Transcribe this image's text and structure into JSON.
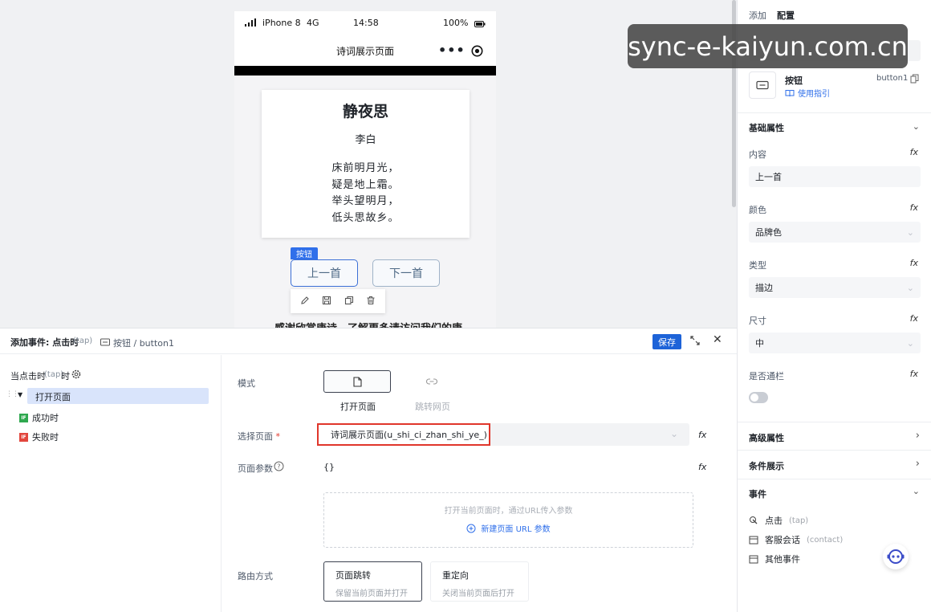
{
  "phone": {
    "carrier": "iPhone 8",
    "network": "4G",
    "time": "14:58",
    "battery": "100%",
    "nav_title": "诗词展示页面",
    "poem": {
      "title": "静夜思",
      "author": "李白",
      "lines": [
        "床前明月光，",
        "疑是地上霜。",
        "举头望明月，",
        "低头思故乡。"
      ]
    },
    "prev_label": "上一首",
    "next_label": "下一首",
    "selected_tag": "按钮",
    "cut_text": "感谢欣赏唐诗，了解更多请访问我们的唐"
  },
  "watermark": "sync-e-kaiyun.com.cn",
  "right_panel": {
    "tabs": [
      "添加",
      "配置"
    ],
    "component_name": "按钮",
    "component_id": "button1",
    "guide_link": "使用指引",
    "basic_section": "基础属性",
    "props": [
      {
        "label": "内容",
        "value": "上一首"
      },
      {
        "label": "颜色",
        "value": "品牌色"
      },
      {
        "label": "类型",
        "value": "描边"
      },
      {
        "label": "尺寸",
        "value": "中"
      }
    ],
    "full_width_label": "是否通栏",
    "full_width_on": false,
    "advanced_section": "高级属性",
    "condition_section": "条件展示",
    "events_section": "事件",
    "events": [
      {
        "label": "点击",
        "sub": "(tap)"
      },
      {
        "label": "客服会话",
        "sub": "(contact)"
      },
      {
        "label": "其他事件",
        "sub": ""
      }
    ]
  },
  "editor": {
    "title": "添加事件: 点击时",
    "title_sub": "(tap)",
    "component_path": "按钮 / button1",
    "save_label": "保存",
    "trigger_label": "当点击时",
    "trigger_sub": "(tap)",
    "trigger_suffix": "时",
    "tree": [
      {
        "label": "打开页面",
        "badge": ""
      },
      {
        "label": "成功时",
        "badge": "IF"
      },
      {
        "label": "失败时",
        "badge": "IF"
      }
    ],
    "mode_label": "模式",
    "mode_options": [
      "打开页面",
      "跳转网页"
    ],
    "page_select_label": "选择页面",
    "page_select_value": "诗词展示页面(u_shi_ci_zhan_shi_ye_)",
    "params_label": "页面参数",
    "params_value": "{}",
    "params_hint": "打开当前页面时，通过URL传入参数",
    "new_param_label": "新建页面 URL 参数",
    "route_label": "路由方式",
    "route_options": [
      {
        "title": "页面跳转",
        "sub": "保留当前页面并打开"
      },
      {
        "title": "重定向",
        "sub": "关闭当前页面后打开"
      }
    ]
  },
  "colors": {
    "brand": "#1d63d8",
    "highlight_border": "#e0362b",
    "badge_red": "#e2463d",
    "badge_green": "#2fa84f"
  }
}
